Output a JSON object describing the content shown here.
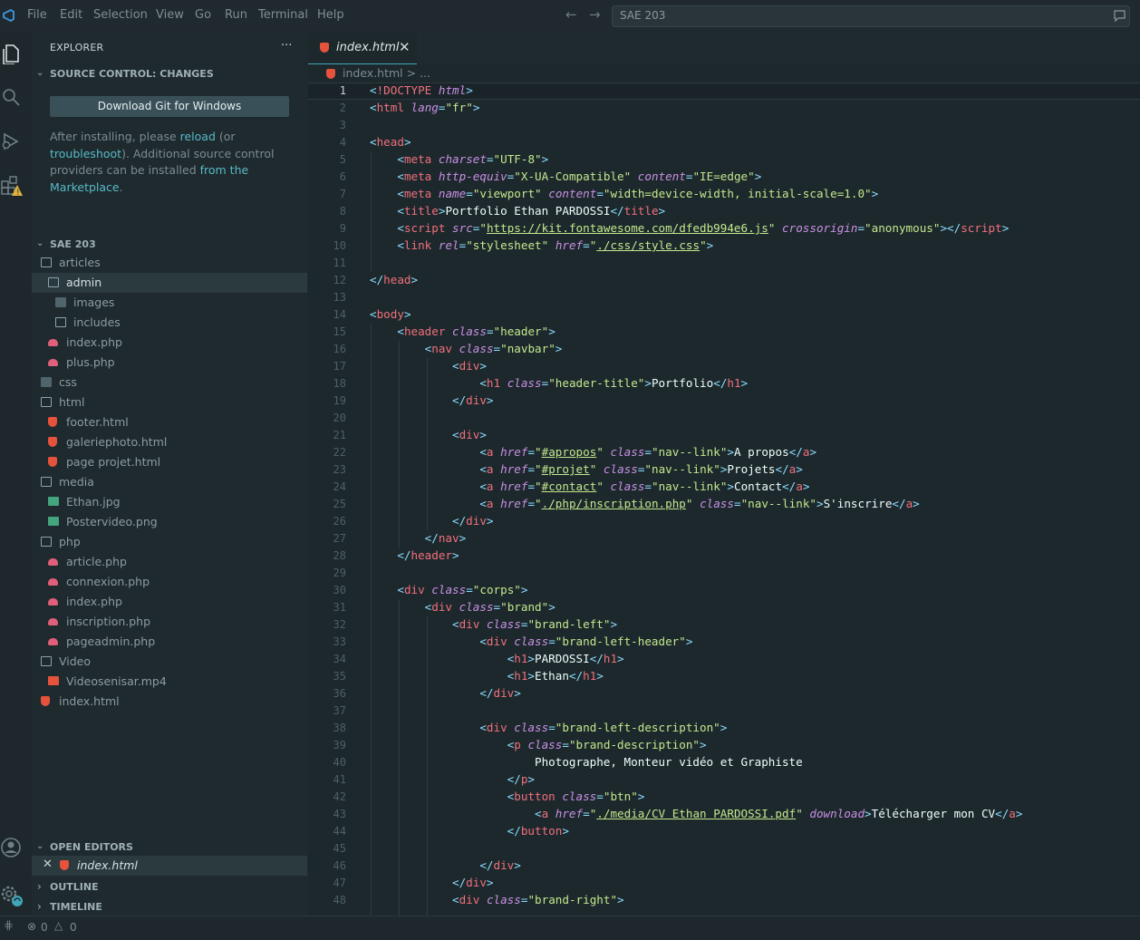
{
  "window": {
    "menu": [
      "File",
      "Edit",
      "Selection",
      "View",
      "Go",
      "Run",
      "Terminal",
      "Help"
    ],
    "search": "SAE 203"
  },
  "sidebar": {
    "title": "EXPLORER",
    "more": "···",
    "source_control": {
      "title": "SOURCE CONTROL: CHANGES",
      "button": "Download Git for Windows",
      "msg_1": "After installing, please ",
      "link_reload": "reload",
      "msg_2": " (or ",
      "link_troubleshoot": "troubleshoot",
      "msg_3": "). Additional source control providers can be installed ",
      "link_market": "from the Marketplace",
      "msg_4": "."
    },
    "project": {
      "title": "SAE 203",
      "tree": [
        {
          "label": "articles",
          "icon": "folder"
        },
        {
          "label": "admin",
          "icon": "folder"
        },
        {
          "label": "images",
          "icon": "folder-images"
        },
        {
          "label": "includes",
          "icon": "folder"
        },
        {
          "label": "index.php",
          "icon": "php"
        },
        {
          "label": "plus.php",
          "icon": "php"
        },
        {
          "label": "css",
          "icon": "folder-css"
        },
        {
          "label": "html",
          "icon": "folder"
        },
        {
          "label": "footer.html",
          "icon": "html"
        },
        {
          "label": "galeriephoto.html",
          "icon": "html"
        },
        {
          "label": "page projet.html",
          "icon": "html"
        },
        {
          "label": "media",
          "icon": "folder"
        },
        {
          "label": "Ethan.jpg",
          "icon": "image"
        },
        {
          "label": "Postervideo.png",
          "icon": "image"
        },
        {
          "label": "php",
          "icon": "folder"
        },
        {
          "label": "article.php",
          "icon": "php"
        },
        {
          "label": "connexion.php",
          "icon": "php"
        },
        {
          "label": "index.php",
          "icon": "php"
        },
        {
          "label": "inscription.php",
          "icon": "php"
        },
        {
          "label": "pageadmin.php",
          "icon": "php"
        },
        {
          "label": "Video",
          "icon": "folder"
        },
        {
          "label": "Videosenisar.mp4",
          "icon": "video"
        },
        {
          "label": "index.html",
          "icon": "html"
        }
      ]
    },
    "open_editors": {
      "title": "OPEN EDITORS",
      "file": "index.html"
    },
    "outline": "OUTLINE",
    "timeline": "TIMELINE"
  },
  "editor": {
    "tab": "index.html",
    "breadcrumb": "index.html > ...",
    "lines": [
      "1",
      "2",
      "3",
      "4",
      "5",
      "6",
      "7",
      "8",
      "9",
      "10",
      "11",
      "12",
      "13",
      "14",
      "15",
      "16",
      "17",
      "18",
      "19",
      "20",
      "21",
      "22",
      "23",
      "24",
      "25",
      "26",
      "27",
      "28",
      "29",
      "30",
      "31",
      "32",
      "33",
      "34",
      "35",
      "36",
      "37",
      "38",
      "39",
      "40",
      "41",
      "42",
      "43",
      "44",
      "45",
      "46",
      "47",
      "48"
    ]
  },
  "status": {
    "errors": "0",
    "warnings": "0"
  },
  "colors": {
    "accent": "#3fa7b8",
    "tag": "#f0707d",
    "attr": "#c990e6",
    "string": "#c3e88d"
  }
}
